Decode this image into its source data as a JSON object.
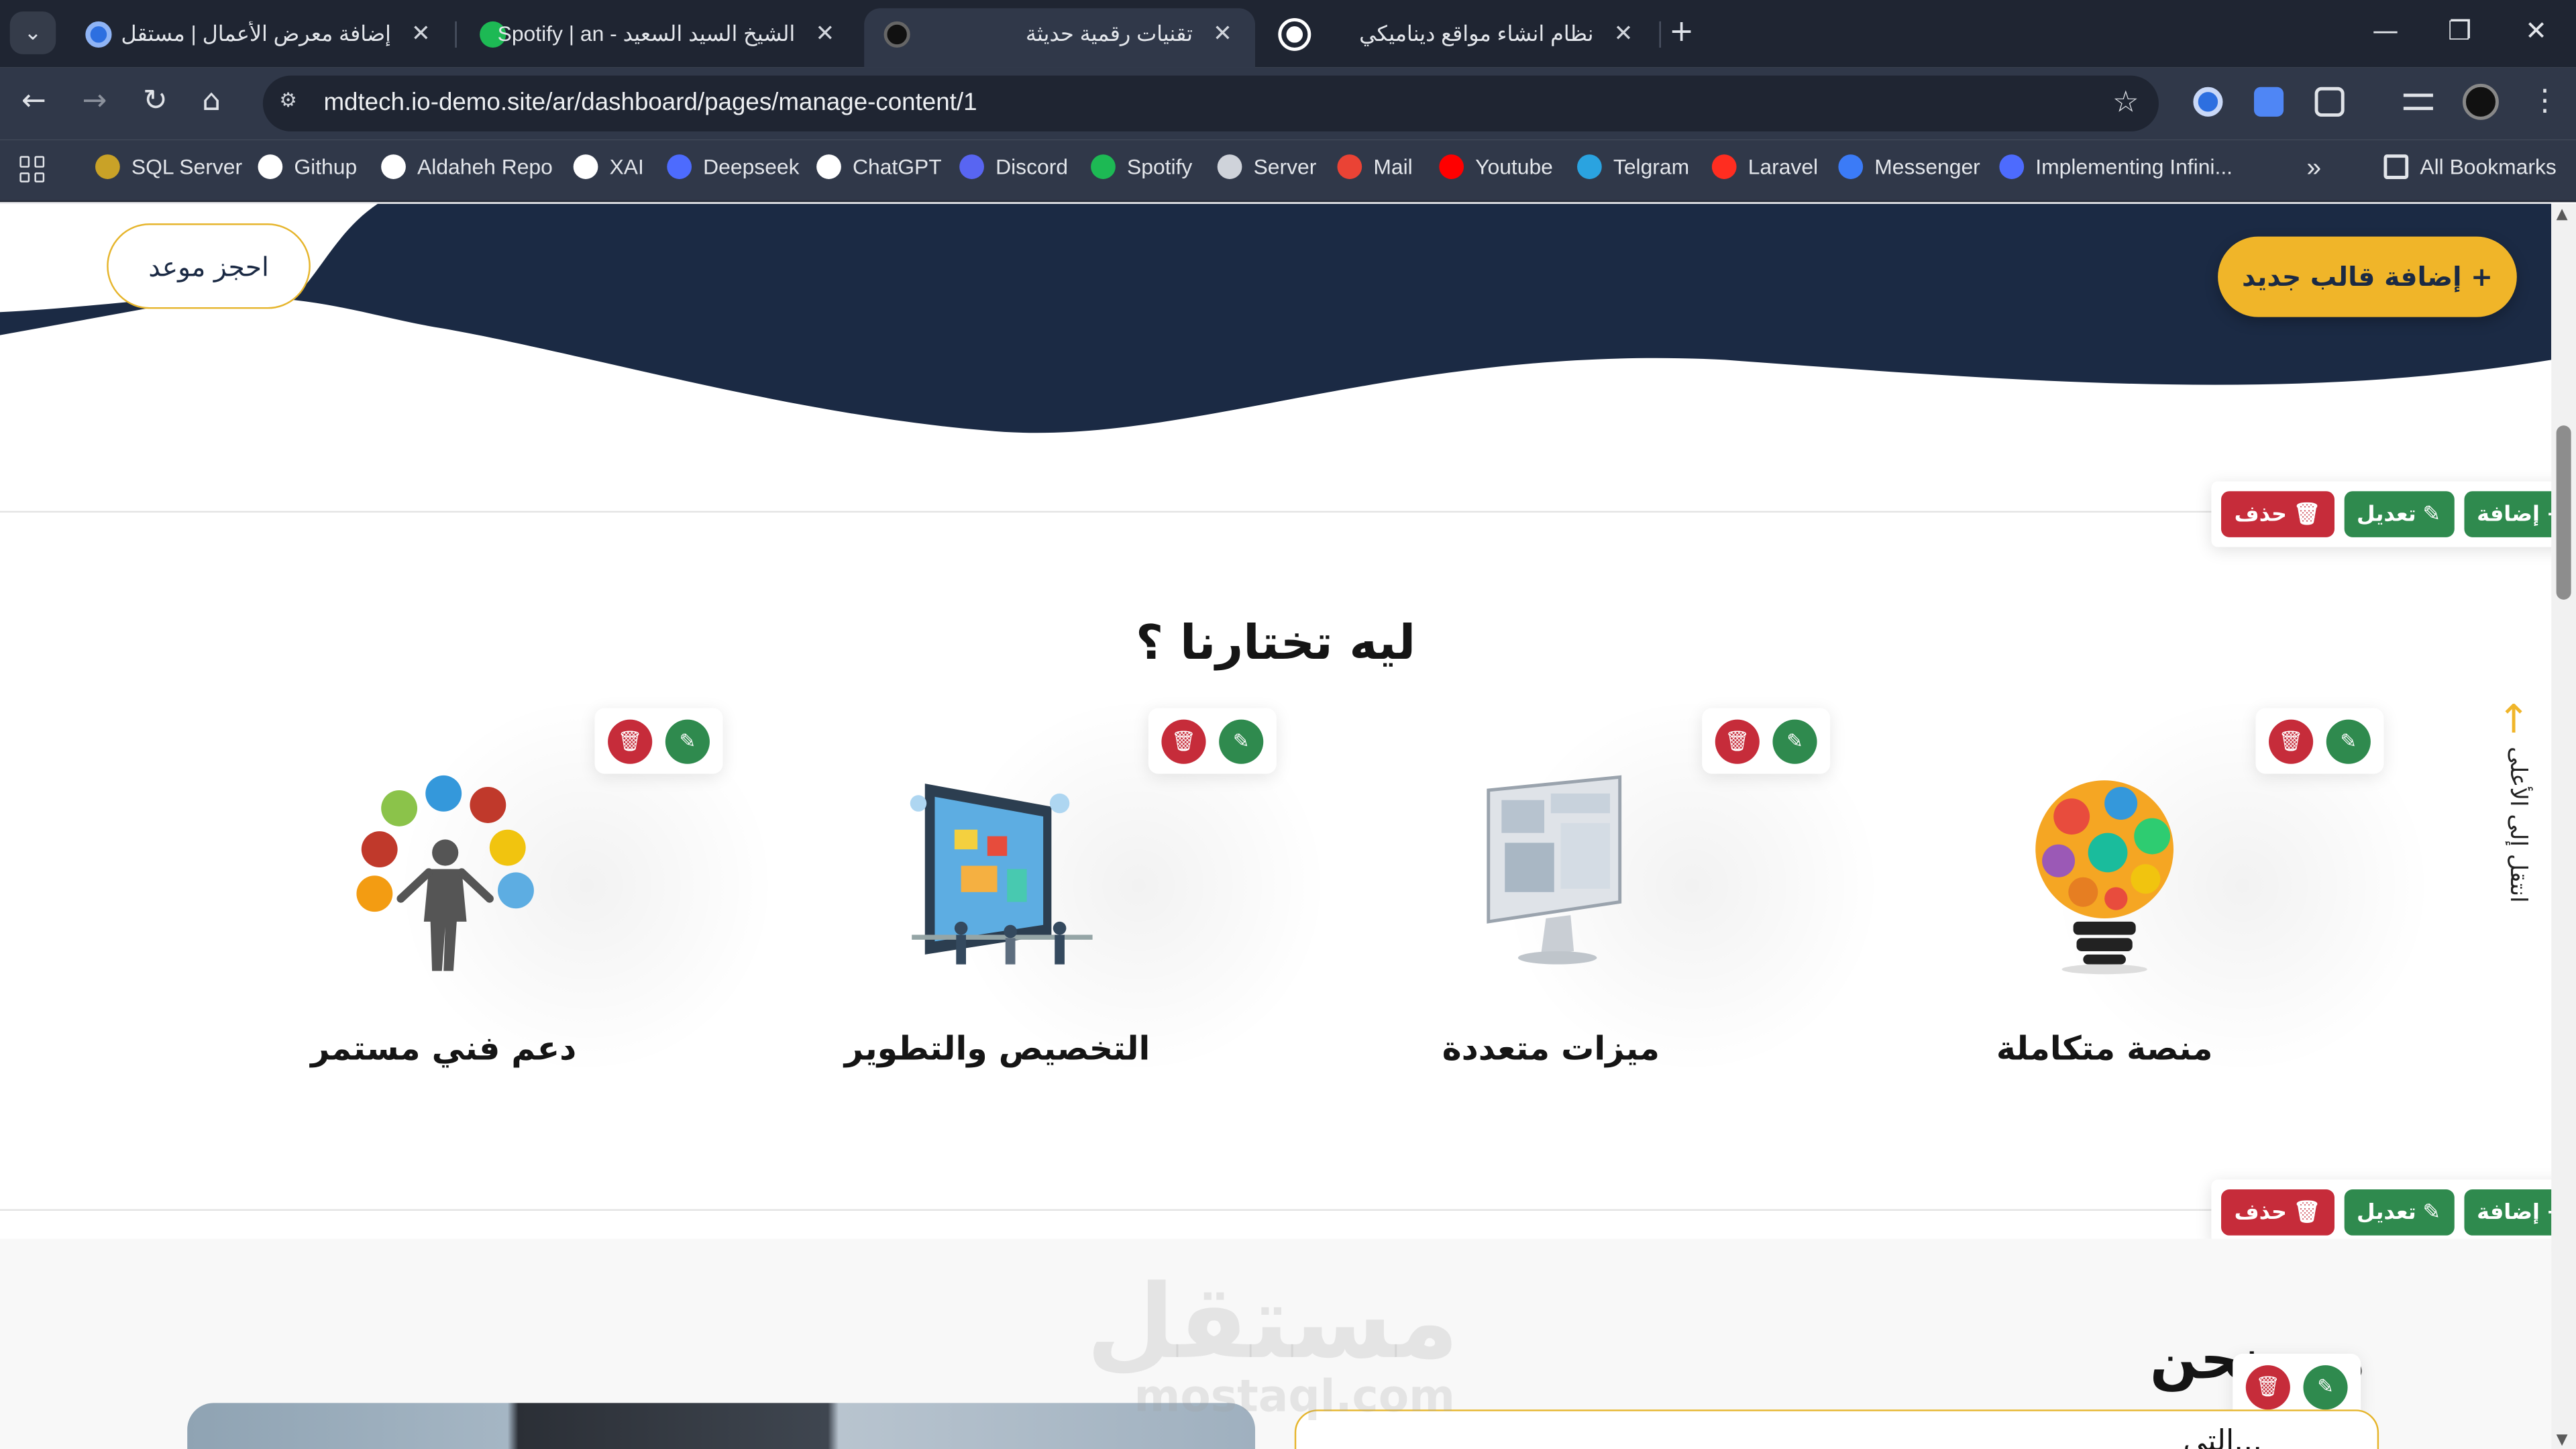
{
  "browser": {
    "tabs": [
      {
        "title": "إضافة معرض الأعمال | مستقل",
        "favicon": "mostaql-icon",
        "active": false
      },
      {
        "title": "الشيخ السيد السعيد - Spotify | an",
        "favicon": "spotify-icon",
        "active": false
      },
      {
        "title": "تقنيات رقمية حديثة",
        "favicon": "site-logo-icon",
        "active": true
      },
      {
        "title": "نظام انشاء مواقع ديناميكي",
        "favicon": "chatgpt-icon",
        "active": false
      }
    ],
    "url": "mdtech.io-demo.site/ar/dashboard/pages/manage-content/1",
    "bookmarks": [
      {
        "label": "SQL Server",
        "icon": "sql-server-icon",
        "color": "#c9a227"
      },
      {
        "label": "Githup",
        "icon": "github-icon",
        "color": "#ffffff"
      },
      {
        "label": "Aldaheh Repo",
        "icon": "github-icon",
        "color": "#ffffff"
      },
      {
        "label": "XAI",
        "icon": "xai-icon",
        "color": "#ffffff"
      },
      {
        "label": "Deepseek",
        "icon": "deepseek-icon",
        "color": "#4d6bfe"
      },
      {
        "label": "ChatGPT",
        "icon": "chatgpt-icon",
        "color": "#ffffff"
      },
      {
        "label": "Discord",
        "icon": "discord-icon",
        "color": "#5865f2"
      },
      {
        "label": "Spotify",
        "icon": "spotify-icon",
        "color": "#1db954"
      },
      {
        "label": "Server",
        "icon": "globe-icon",
        "color": "#cfd3da"
      },
      {
        "label": "Mail",
        "icon": "gmail-icon",
        "color": "#ea4335"
      },
      {
        "label": "Youtube",
        "icon": "youtube-icon",
        "color": "#ff0000"
      },
      {
        "label": "Telgram",
        "icon": "telegram-icon",
        "color": "#2aa3e0"
      },
      {
        "label": "Laravel",
        "icon": "laravel-icon",
        "color": "#ff2d20"
      },
      {
        "label": "Messenger",
        "icon": "messenger-icon",
        "color": "#3b7bf7"
      },
      {
        "label": "Implementing Infini...",
        "icon": "deepseek-icon",
        "color": "#4d6bfe"
      }
    ],
    "all_bookmarks": "All Bookmarks"
  },
  "page": {
    "hero": {
      "book_button": "احجز موعد",
      "add_template_button": "+ إضافة قالب جديد"
    },
    "section_controls": {
      "add": "إضافة",
      "edit": "تعديل",
      "delete": "حذف"
    },
    "why_us": {
      "title": "ليه تختارنا ؟",
      "features": [
        {
          "label": "منصة متكاملة",
          "icon": "lightbulb-apps-icon"
        },
        {
          "label": "ميزات متعددة",
          "icon": "monitor-website-icon"
        },
        {
          "label": "التخصيص والتطوير",
          "icon": "tablet-team-icon"
        },
        {
          "label": "دعم فني مستمر",
          "icon": "person-support-icon"
        }
      ]
    },
    "back_to_top": "انتقل إلى الأعلى",
    "about": {
      "title": "من نحن",
      "card_peek": "...التي",
      "watermark_ar": "مستقل",
      "watermark_en": "mostaql.com"
    }
  },
  "colors": {
    "navy": "#1b2a44",
    "gold": "#f0b529",
    "danger": "#c62c3a",
    "success": "#2f8a4e",
    "chrome_dark": "#1f2532",
    "chrome": "#303849"
  }
}
